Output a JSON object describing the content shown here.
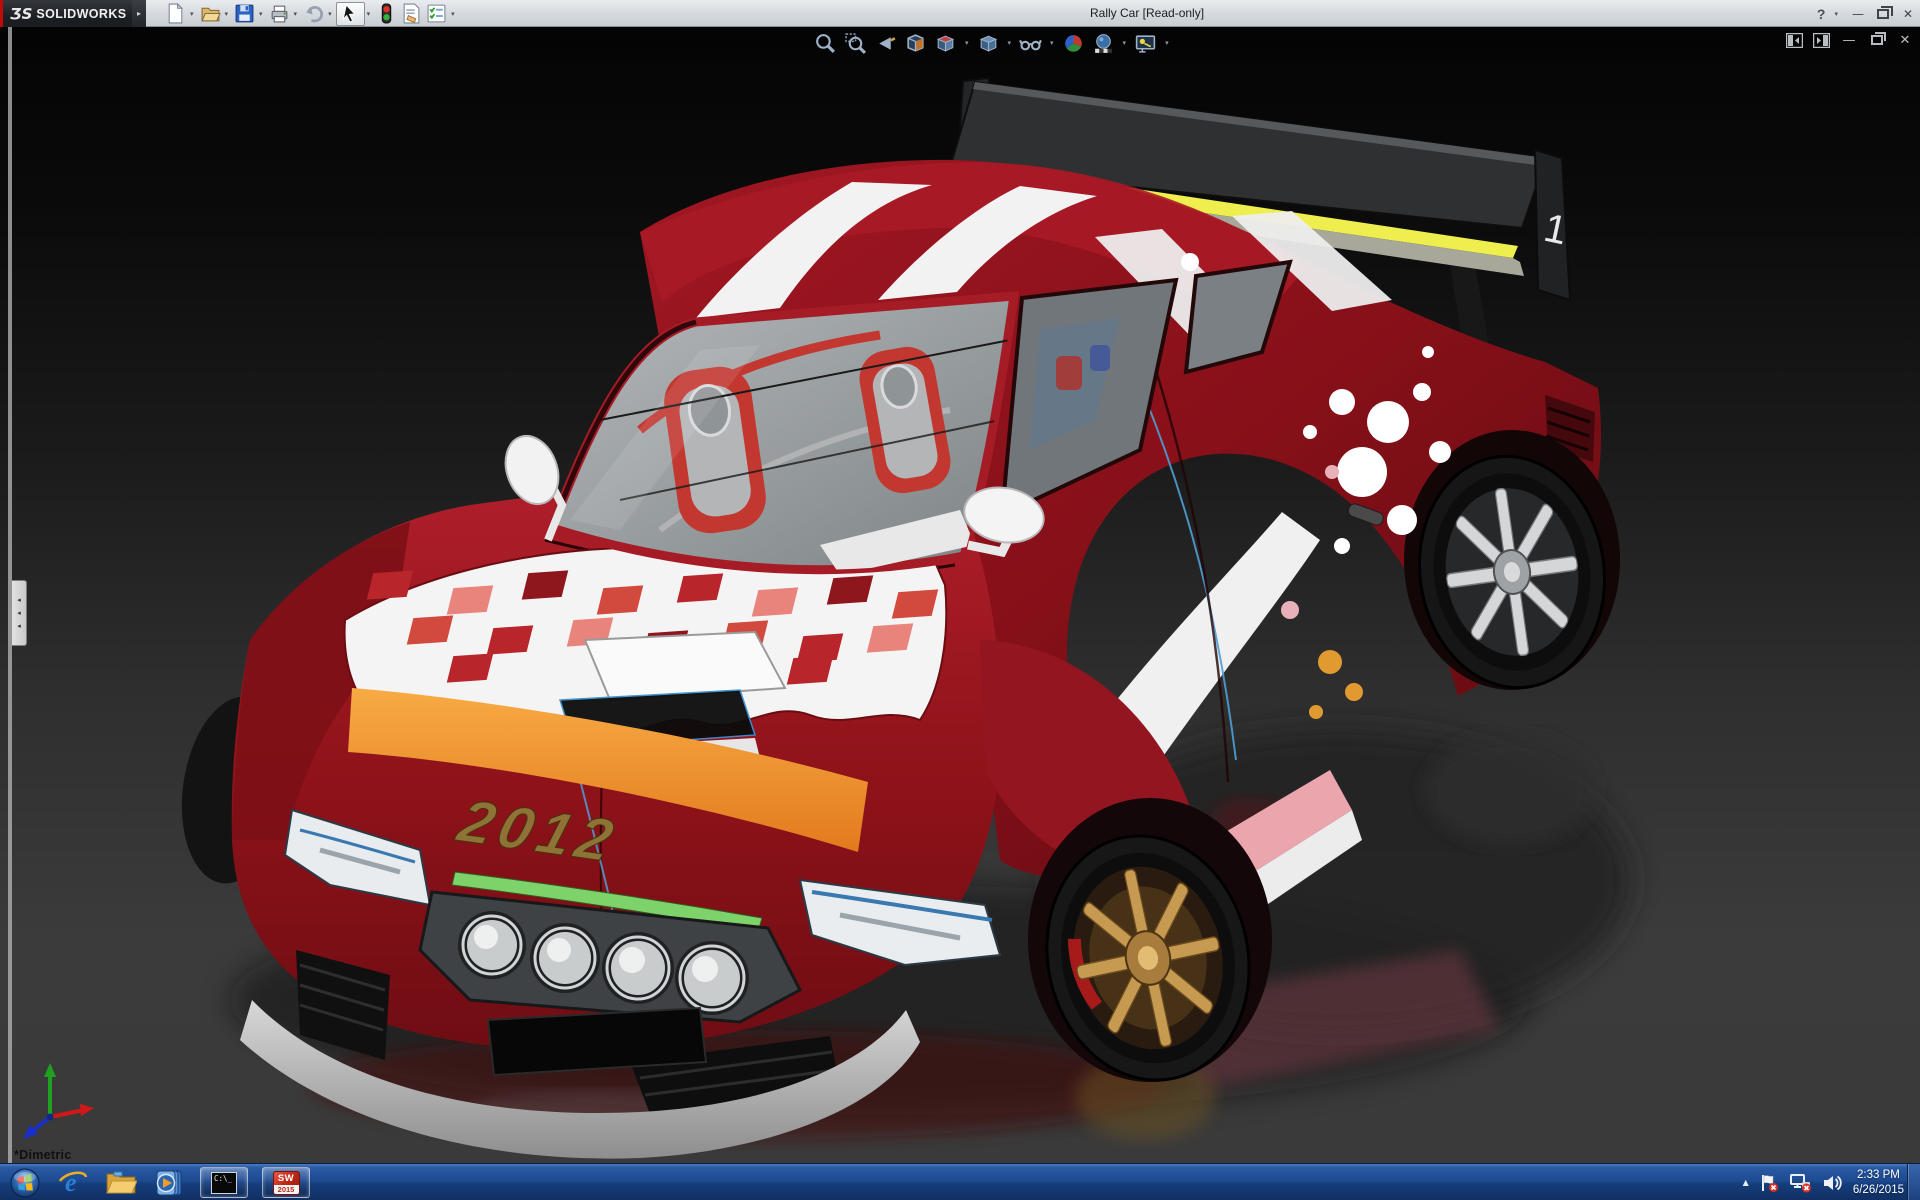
{
  "titlebar": {
    "logo_glyph": "ƷS",
    "logo_text": "SOLIDWORKS",
    "title": "Rally Car [Read-only]",
    "help_glyph": "?"
  },
  "glyphs": {
    "dropdown": "▾",
    "menu_expand": "▸",
    "minimize": "—",
    "close": "✕",
    "tray_expand": "▲",
    "collapse_arrow": "◂"
  },
  "main_toolbar": {
    "items": [
      "new",
      "open",
      "save",
      "print",
      "undo",
      "select",
      "rebuild-indicator",
      "file-properties",
      "options"
    ]
  },
  "hud_toolbar": {
    "items": [
      "zoom-to-fit",
      "zoom-to-area",
      "previous-view",
      "section-view",
      "view-orientation",
      "display-style",
      "hide-show-items",
      "edit-appearance",
      "apply-scene",
      "view-settings"
    ]
  },
  "doc_window_controls": [
    "show-feature-pane",
    "show-task-pane",
    "minimize",
    "restore",
    "close"
  ],
  "viewport": {
    "orientation_label": "*Dimetric",
    "decals": {
      "hood_year": "2012",
      "wing_number": "1"
    }
  },
  "taskbar": {
    "items": [
      "start",
      "internet-explorer",
      "windows-explorer",
      "media-player",
      "command-prompt",
      "solidworks-2015"
    ],
    "cmd_icon_text": "C:\\_",
    "sw_icon_text": "SW",
    "sw_icon_year": "2015",
    "ie_glyph": "e",
    "tray": {
      "time": "2:33 PM",
      "date": "6/26/2015"
    }
  },
  "colors": {
    "accent_red": "#9e1620",
    "taskbar_blue": "#1e4b92",
    "decal_orange": "#ef9630",
    "wing_yellow": "#eeee4e",
    "accent_green": "#7ed26a"
  }
}
